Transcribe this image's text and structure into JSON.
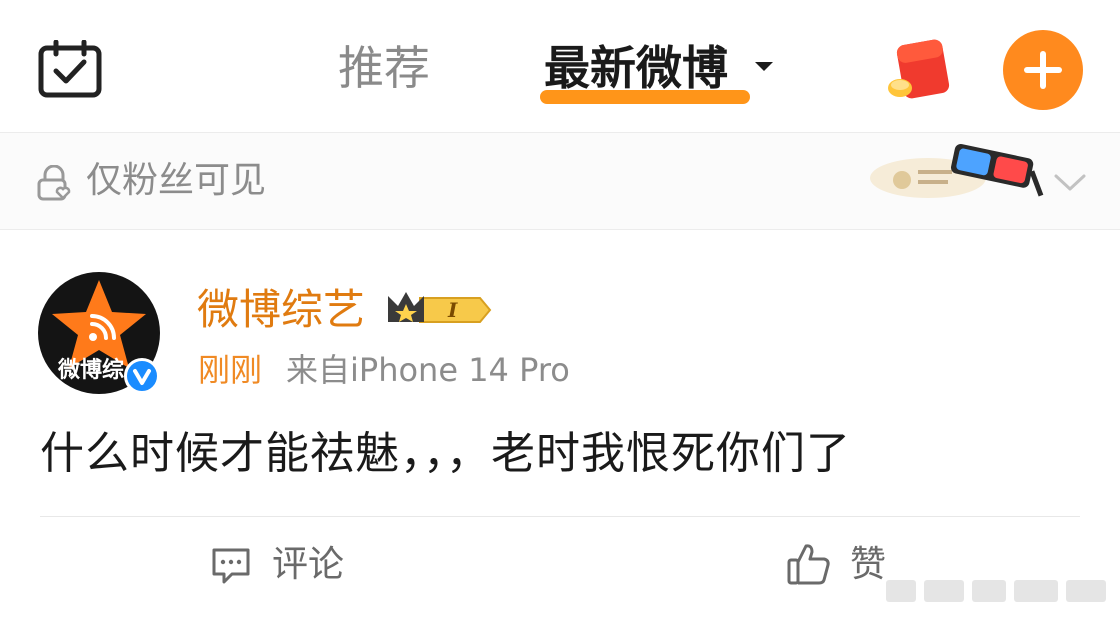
{
  "header": {
    "tabs": [
      {
        "label": "推荐",
        "active": false
      },
      {
        "label": "最新微博",
        "active": true
      }
    ],
    "icons": {
      "calendar": "calendar-check-icon",
      "red_packet": "red-packet-icon",
      "compose": "plus-icon"
    },
    "accent_color": "#ff8a1e"
  },
  "visibility": {
    "label": "仅粉丝可见",
    "icon": "lock-heart-icon"
  },
  "post": {
    "author": "微博综艺",
    "avatar_caption": "微博综",
    "verified": true,
    "level_badge": "I",
    "time": "刚刚",
    "source": "来自iPhone 14 Pro",
    "text": "什么时候才能祛魅，，，老时我恨死你们了"
  },
  "actions": {
    "comment": "评论",
    "like": "赞"
  }
}
